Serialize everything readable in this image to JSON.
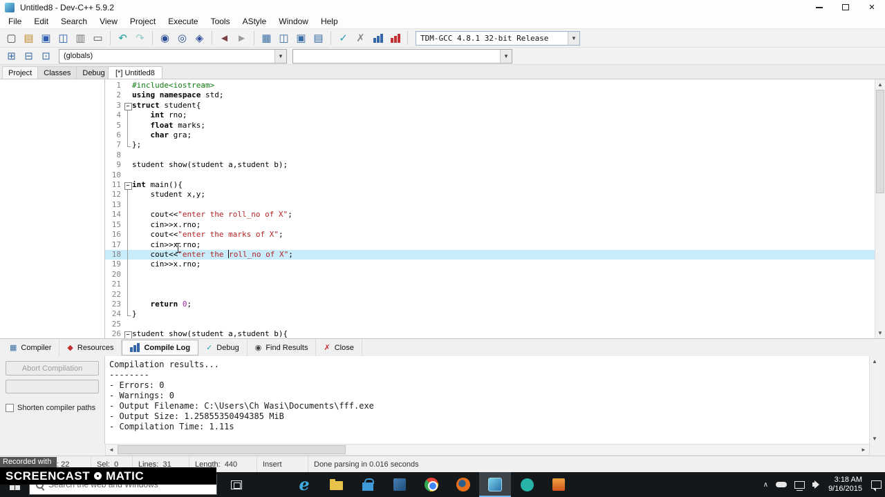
{
  "window": {
    "title": "Untitled8 - Dev-C++ 5.9.2",
    "close_glyph": "×"
  },
  "menu": [
    "File",
    "Edit",
    "Search",
    "View",
    "Project",
    "Execute",
    "Tools",
    "AStyle",
    "Window",
    "Help"
  ],
  "toolbar1": {
    "groups": [
      [
        {
          "name": "new-file-icon",
          "g": "▢",
          "c": "#4a4a4a"
        },
        {
          "name": "open-icon",
          "g": "▤",
          "c": "#c08a2a"
        },
        {
          "name": "save-icon",
          "g": "▣",
          "c": "#2e5fb0"
        },
        {
          "name": "save-all-icon",
          "g": "◫",
          "c": "#2e5fb0"
        },
        {
          "name": "close-file-icon",
          "g": "▥",
          "c": "#777777"
        },
        {
          "name": "print-icon",
          "g": "▭",
          "c": "#555555"
        }
      ],
      [
        {
          "name": "undo-icon",
          "g": "↶",
          "c": "#1f9e9e"
        },
        {
          "name": "redo-icon",
          "g": "↷",
          "c": "#93cccc"
        }
      ],
      [
        {
          "name": "find-icon",
          "g": "◉",
          "c": "#2d4e97"
        },
        {
          "name": "replace-icon",
          "g": "◎",
          "c": "#2d4e97"
        },
        {
          "name": "goto-line-icon",
          "g": "◈",
          "c": "#2d4e97"
        }
      ],
      [
        {
          "name": "back-icon",
          "g": "◄",
          "c": "#7d4040"
        },
        {
          "name": "forward-icon",
          "g": "►",
          "c": "#9a9a9a"
        }
      ],
      [
        {
          "name": "project-grid-icon",
          "g": "▦",
          "c": "#3b6ea5"
        },
        {
          "name": "split-view-icon",
          "g": "◫",
          "c": "#3b6ea5"
        },
        {
          "name": "full-screen-icon",
          "g": "▣",
          "c": "#3b6ea5"
        },
        {
          "name": "window-list-icon",
          "g": "▤",
          "c": "#3b6ea5"
        }
      ],
      [
        {
          "name": "syntax-check-icon",
          "g": "✓",
          "c": "#2a9db5"
        },
        {
          "name": "clean-icon",
          "g": "✗",
          "c": "#8a8a8a"
        },
        {
          "name": "profile-icon",
          "t": "bars",
          "c": "#3566a8"
        },
        {
          "name": "delete-profiling-icon",
          "t": "bars",
          "c": "#c03030"
        }
      ]
    ],
    "compiler_combobox": "TDM-GCC 4.8.1 32-bit Release"
  },
  "toolbar2": {
    "icons": [
      {
        "name": "insert-icon",
        "g": "⊞",
        "c": "#3b6ea5"
      },
      {
        "name": "toggle-bookmark-icon",
        "g": "⊟",
        "c": "#3b6ea5"
      },
      {
        "name": "goto-bookmark-icon",
        "g": "⊡",
        "c": "#3b6ea5"
      }
    ],
    "globals_combobox": "(globals)",
    "members_combobox": ""
  },
  "left_panel": {
    "tabs": [
      "Project",
      "Classes",
      "Debug"
    ],
    "active_tab": "Project"
  },
  "editor": {
    "tab_title": "[*] Untitled8",
    "current_line": 18,
    "lines": [
      {
        "n": 1,
        "fold": "",
        "segs": [
          [
            "pre",
            "#include<iostream>"
          ]
        ]
      },
      {
        "n": 2,
        "fold": "",
        "segs": [
          [
            "kw",
            "using"
          ],
          [
            "pl",
            " "
          ],
          [
            "kw",
            "namespace"
          ],
          [
            "pl",
            " std;"
          ]
        ]
      },
      {
        "n": 3,
        "fold": "start",
        "segs": [
          [
            "kw",
            "struct"
          ],
          [
            "pl",
            " student{"
          ]
        ]
      },
      {
        "n": 4,
        "fold": "mid",
        "segs": [
          [
            "pl",
            "    "
          ],
          [
            "kw",
            "int"
          ],
          [
            "pl",
            " rno;"
          ]
        ]
      },
      {
        "n": 5,
        "fold": "mid",
        "segs": [
          [
            "pl",
            "    "
          ],
          [
            "kw",
            "float"
          ],
          [
            "pl",
            " marks;"
          ]
        ]
      },
      {
        "n": 6,
        "fold": "mid",
        "segs": [
          [
            "pl",
            "    "
          ],
          [
            "kw",
            "char"
          ],
          [
            "pl",
            " gra;"
          ]
        ]
      },
      {
        "n": 7,
        "fold": "end",
        "segs": [
          [
            "pl",
            "};"
          ]
        ]
      },
      {
        "n": 8,
        "fold": "",
        "segs": []
      },
      {
        "n": 9,
        "fold": "",
        "segs": [
          [
            "pl",
            "student show(student a,student b);"
          ]
        ]
      },
      {
        "n": 10,
        "fold": "",
        "segs": []
      },
      {
        "n": 11,
        "fold": "start",
        "segs": [
          [
            "kw",
            "int"
          ],
          [
            "pl",
            " main(){"
          ]
        ]
      },
      {
        "n": 12,
        "fold": "mid",
        "segs": [
          [
            "pl",
            "    student x,y;"
          ]
        ]
      },
      {
        "n": 13,
        "fold": "mid",
        "segs": []
      },
      {
        "n": 14,
        "fold": "mid",
        "segs": [
          [
            "pl",
            "    cout<<"
          ],
          [
            "str",
            "\"enter the roll_no of X\""
          ],
          [
            "pl",
            ";"
          ]
        ]
      },
      {
        "n": 15,
        "fold": "mid",
        "segs": [
          [
            "pl",
            "    cin>>x.rno;"
          ]
        ]
      },
      {
        "n": 16,
        "fold": "mid",
        "segs": [
          [
            "pl",
            "    cout<<"
          ],
          [
            "str",
            "\"enter the marks of X\""
          ],
          [
            "pl",
            ";"
          ]
        ]
      },
      {
        "n": 17,
        "fold": "mid",
        "segs": [
          [
            "pl",
            "    cin>>x.rno;"
          ]
        ]
      },
      {
        "n": 18,
        "fold": "mid",
        "segs": [
          [
            "pl",
            "    cout<<"
          ],
          [
            "str",
            "\"enter the "
          ],
          [
            "caret",
            ""
          ],
          [
            "str",
            "roll_no of X\""
          ],
          [
            "pl",
            ";"
          ]
        ]
      },
      {
        "n": 19,
        "fold": "mid",
        "segs": [
          [
            "pl",
            "    cin>>x.rno;"
          ]
        ]
      },
      {
        "n": 20,
        "fold": "mid",
        "segs": []
      },
      {
        "n": 21,
        "fold": "mid",
        "segs": []
      },
      {
        "n": 22,
        "fold": "mid",
        "segs": []
      },
      {
        "n": 23,
        "fold": "mid",
        "segs": [
          [
            "pl",
            "    "
          ],
          [
            "kw",
            "return"
          ],
          [
            "pl",
            " "
          ],
          [
            "num",
            "0"
          ],
          [
            "pl",
            ";"
          ]
        ]
      },
      {
        "n": 24,
        "fold": "end",
        "segs": [
          [
            "pl",
            "}"
          ]
        ]
      },
      {
        "n": 25,
        "fold": "",
        "segs": []
      },
      {
        "n": 26,
        "fold": "start",
        "segs": [
          [
            "pl",
            "student show(student a,student b){"
          ]
        ]
      }
    ]
  },
  "bottom_panel": {
    "tabs": [
      {
        "label": "Compiler",
        "icon": "compiler-icon",
        "g": "▦",
        "c": "#3b6ea5"
      },
      {
        "label": "Resources",
        "icon": "resources-icon",
        "g": "◆",
        "c": "#c03030"
      },
      {
        "label": "Compile Log",
        "icon": "compile-log-icon",
        "g": "bars",
        "c": "#3566a8",
        "active": true
      },
      {
        "label": "Debug",
        "icon": "debug-icon",
        "g": "✓",
        "c": "#2a9db5"
      },
      {
        "label": "Find Results",
        "icon": "find-results-icon",
        "g": "◉",
        "c": "#444444"
      },
      {
        "label": "Close",
        "icon": "close-panel-icon",
        "g": "✗",
        "c": "#c03030"
      }
    ],
    "abort_button_label": "Abort Compilation",
    "shorten_paths_label": "Shorten compiler paths",
    "log_lines": [
      "Compilation results...",
      "--------",
      "- Errors: 0",
      "- Warnings: 0",
      "- Output Filename: C:\\Users\\Ch Wasi\\Documents\\fff.exe",
      "- Output Size: 1.25855350494385 MiB",
      "- Compilation Time: 1.11s"
    ]
  },
  "status_bar": {
    "line_col": "Line: 18      Col: 22",
    "sel": "Sel:  0",
    "lines": "Lines:  31",
    "length": "Length:  440",
    "insert_mode": "Insert",
    "message": "Done parsing in 0.016 seconds"
  },
  "watermark": {
    "recorded_with": "Recorded with",
    "brand_left": "SCREENCAST",
    "brand_right": "MATIC"
  },
  "taskbar": {
    "search_placeholder": "Search the web and Windows",
    "apps": [
      {
        "name": "edge",
        "g": "e"
      },
      {
        "name": "file-explorer"
      },
      {
        "name": "store"
      },
      {
        "name": "app-blue"
      },
      {
        "name": "chrome"
      },
      {
        "name": "firefox"
      },
      {
        "name": "dev-cpp",
        "active": true
      },
      {
        "name": "app-teal"
      },
      {
        "name": "app-orange"
      }
    ],
    "clock": {
      "time": "3:18 AM",
      "date": "9/16/2015"
    }
  }
}
